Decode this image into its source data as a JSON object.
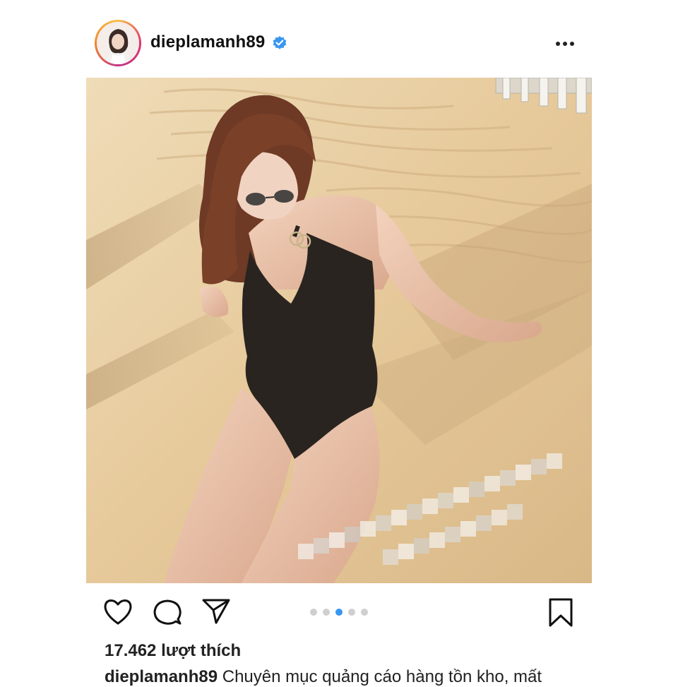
{
  "post": {
    "username": "dieplamanh89",
    "verified": true,
    "menu_icon": "more-horizontal-icon",
    "avatar_icon": "profile-avatar",
    "photo_description_icon": "post-photo",
    "carousel": {
      "count": 5,
      "active_index": 2
    },
    "likes_text": "17.462 lượt thích",
    "caption": {
      "username": "dieplamanh89",
      "text": "Chuyên mục quảng cáo hàng tồn kho, mất"
    }
  },
  "colors": {
    "accent_blue": "#3897f0",
    "verified_badge": "#3897f0",
    "text": "#111111",
    "sand": "#e8cfa3"
  },
  "icons": {
    "like": "heart-icon",
    "comment": "comment-bubble-icon",
    "share": "paper-plane-icon",
    "save": "bookmark-icon"
  }
}
